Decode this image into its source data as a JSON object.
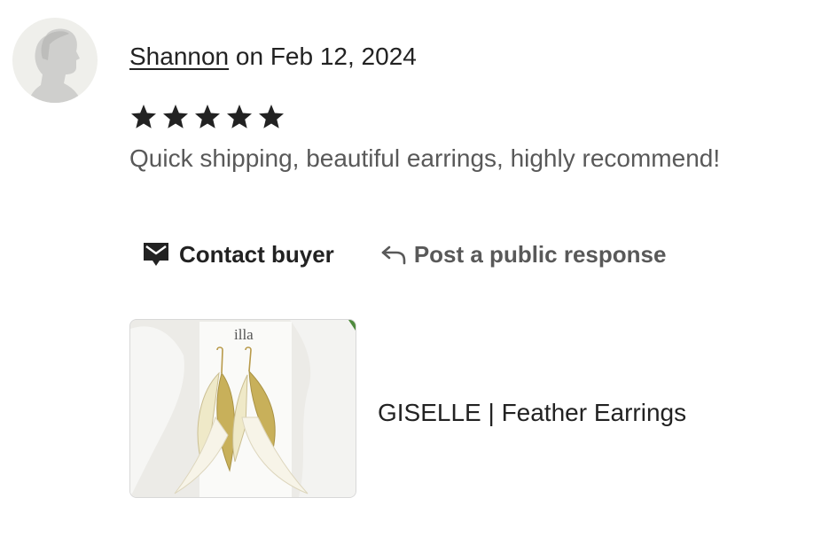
{
  "review": {
    "reviewer_name": "Shannon",
    "date_text": " on Feb 12, 2024",
    "rating": 5,
    "rating_max": 5,
    "text": "Quick shipping, beautiful earrings, highly recommend!"
  },
  "actions": {
    "contact_label": "Contact buyer",
    "contact_icon": "envelope-icon",
    "respond_label": "Post a public response",
    "respond_icon": "reply-arrow-icon"
  },
  "listing": {
    "card_brand_text": "illa",
    "title": "GISELLE | Feather Earrings"
  },
  "colors": {
    "text_primary": "#222222",
    "text_secondary": "#595959",
    "star": "#222222",
    "avatar_bg": "#efefeb",
    "avatar_silhouette": "#cfcfcd"
  }
}
